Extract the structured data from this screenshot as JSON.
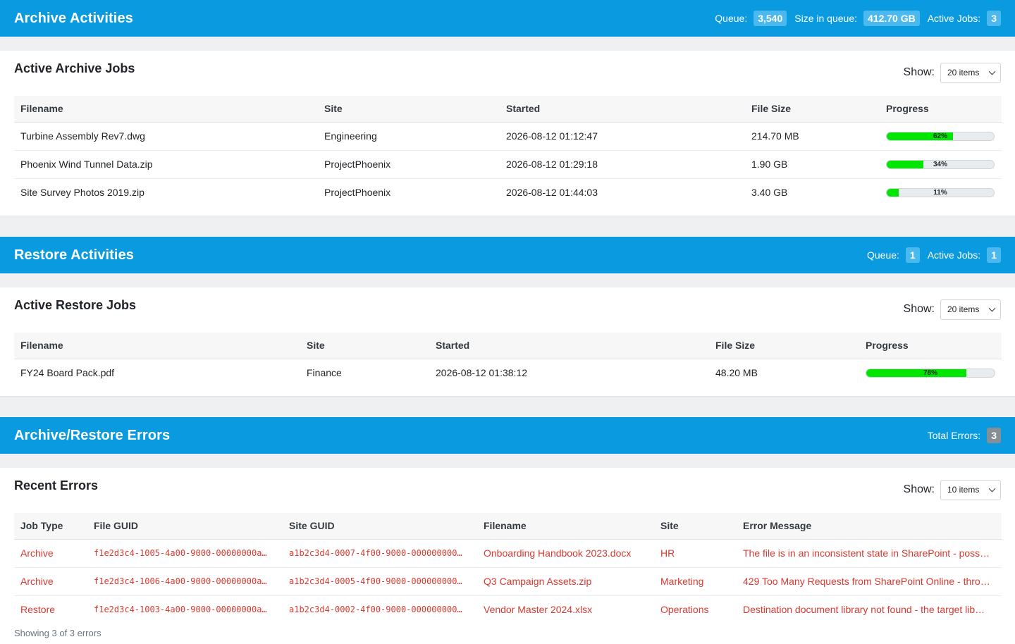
{
  "archive": {
    "title": "Archive Activities",
    "stats": {
      "queue_label": "Queue:",
      "queue_value": "3,540",
      "size_label": "Size in queue:",
      "size_value": "412.70 GB",
      "jobs_label": "Active Jobs:",
      "jobs_value": "3"
    },
    "card_title": "Active Archive Jobs",
    "show_label": "Show:",
    "show_value": "20 items",
    "columns": [
      "Filename",
      "Site",
      "Started",
      "File Size",
      "Progress"
    ],
    "rows": [
      {
        "filename": "Turbine Assembly Rev7.dwg",
        "site": "Engineering",
        "started": "2026-08-12 01:12:47",
        "size": "214.70 MB",
        "progress": 62,
        "progress_text": "62%"
      },
      {
        "filename": "Phoenix Wind Tunnel Data.zip",
        "site": "ProjectPhoenix",
        "started": "2026-08-12 01:29:18",
        "size": "1.90 GB",
        "progress": 34,
        "progress_text": "34%"
      },
      {
        "filename": "Site Survey Photos 2019.zip",
        "site": "ProjectPhoenix",
        "started": "2026-08-12 01:44:03",
        "size": "3.40 GB",
        "progress": 11,
        "progress_text": "11%"
      }
    ]
  },
  "restore": {
    "title": "Restore Activities",
    "stats": {
      "queue_label": "Queue:",
      "queue_value": "1",
      "jobs_label": "Active Jobs:",
      "jobs_value": "1"
    },
    "card_title": "Active Restore Jobs",
    "show_label": "Show:",
    "show_value": "20 items",
    "columns": [
      "Filename",
      "Site",
      "Started",
      "File Size",
      "Progress"
    ],
    "rows": [
      {
        "filename": "FY24 Board Pack.pdf",
        "site": "Finance",
        "started": "2026-08-12 01:38:12",
        "size": "48.20 MB",
        "progress": 78,
        "progress_text": "78%"
      }
    ]
  },
  "errors": {
    "title": "Archive/Restore Errors",
    "stats": {
      "total_label": "Total Errors:",
      "total_value": "3"
    },
    "card_title": "Recent Errors",
    "show_label": "Show:",
    "show_value": "10 items",
    "columns": [
      "Job Type",
      "File GUID",
      "Site GUID",
      "Filename",
      "Site",
      "Error Message"
    ],
    "rows": [
      {
        "job_type": "Archive",
        "file_guid": "f1e2d3c4-1005-4a00-9000-00000000a…",
        "site_guid": "a1b2c3d4-0007-4f00-9000-000000000…",
        "filename": "Onboarding Handbook 2023.docx",
        "site": "HR",
        "message": "The file is in an inconsistent state in SharePoint - poss…"
      },
      {
        "job_type": "Archive",
        "file_guid": "f1e2d3c4-1006-4a00-9000-00000000a…",
        "site_guid": "a1b2c3d4-0005-4f00-9000-000000000…",
        "filename": "Q3 Campaign Assets.zip",
        "site": "Marketing",
        "message": "429 Too Many Requests from SharePoint Online - thro…"
      },
      {
        "job_type": "Restore",
        "file_guid": "f1e2d3c4-1003-4a00-9000-00000000a…",
        "site_guid": "a1b2c3d4-0002-4f00-9000-000000000…",
        "filename": "Vendor Master 2024.xlsx",
        "site": "Operations",
        "message": "Destination document library not found - the target lib…"
      }
    ],
    "footer": "Showing 3 of 3 errors"
  },
  "colors": {
    "header_bg": "#0a9ae0",
    "badge_bg": "#4cb9ee",
    "progress_fill": "#00e600",
    "error_text": "#d63a30"
  }
}
